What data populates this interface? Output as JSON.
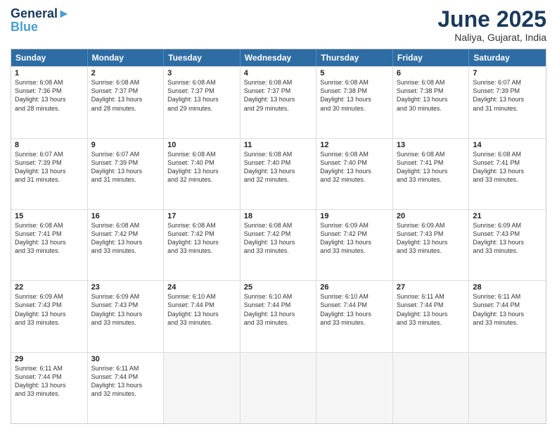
{
  "logo": {
    "line1": "General",
    "line2": "Blue"
  },
  "title": "June 2025",
  "location": "Naliya, Gujarat, India",
  "headers": [
    "Sunday",
    "Monday",
    "Tuesday",
    "Wednesday",
    "Thursday",
    "Friday",
    "Saturday"
  ],
  "rows": [
    [
      {
        "day": "",
        "text": ""
      },
      {
        "day": "2",
        "text": "Sunrise: 6:08 AM\nSunset: 7:37 PM\nDaylight: 13 hours\nand 28 minutes."
      },
      {
        "day": "3",
        "text": "Sunrise: 6:08 AM\nSunset: 7:37 PM\nDaylight: 13 hours\nand 29 minutes."
      },
      {
        "day": "4",
        "text": "Sunrise: 6:08 AM\nSunset: 7:37 PM\nDaylight: 13 hours\nand 29 minutes."
      },
      {
        "day": "5",
        "text": "Sunrise: 6:08 AM\nSunset: 7:38 PM\nDaylight: 13 hours\nand 30 minutes."
      },
      {
        "day": "6",
        "text": "Sunrise: 6:08 AM\nSunset: 7:38 PM\nDaylight: 13 hours\nand 30 minutes."
      },
      {
        "day": "7",
        "text": "Sunrise: 6:07 AM\nSunset: 7:39 PM\nDaylight: 13 hours\nand 31 minutes."
      }
    ],
    [
      {
        "day": "1",
        "text": "Sunrise: 6:08 AM\nSunset: 7:36 PM\nDaylight: 13 hours\nand 28 minutes."
      },
      {
        "day": "",
        "text": ""
      },
      {
        "day": "",
        "text": ""
      },
      {
        "day": "",
        "text": ""
      },
      {
        "day": "",
        "text": ""
      },
      {
        "day": "",
        "text": ""
      },
      {
        "day": "",
        "text": ""
      }
    ],
    [
      {
        "day": "8",
        "text": "Sunrise: 6:07 AM\nSunset: 7:39 PM\nDaylight: 13 hours\nand 31 minutes."
      },
      {
        "day": "9",
        "text": "Sunrise: 6:07 AM\nSunset: 7:39 PM\nDaylight: 13 hours\nand 31 minutes."
      },
      {
        "day": "10",
        "text": "Sunrise: 6:08 AM\nSunset: 7:40 PM\nDaylight: 13 hours\nand 32 minutes."
      },
      {
        "day": "11",
        "text": "Sunrise: 6:08 AM\nSunset: 7:40 PM\nDaylight: 13 hours\nand 32 minutes."
      },
      {
        "day": "12",
        "text": "Sunrise: 6:08 AM\nSunset: 7:40 PM\nDaylight: 13 hours\nand 32 minutes."
      },
      {
        "day": "13",
        "text": "Sunrise: 6:08 AM\nSunset: 7:41 PM\nDaylight: 13 hours\nand 33 minutes."
      },
      {
        "day": "14",
        "text": "Sunrise: 6:08 AM\nSunset: 7:41 PM\nDaylight: 13 hours\nand 33 minutes."
      }
    ],
    [
      {
        "day": "15",
        "text": "Sunrise: 6:08 AM\nSunset: 7:41 PM\nDaylight: 13 hours\nand 33 minutes."
      },
      {
        "day": "16",
        "text": "Sunrise: 6:08 AM\nSunset: 7:42 PM\nDaylight: 13 hours\nand 33 minutes."
      },
      {
        "day": "17",
        "text": "Sunrise: 6:08 AM\nSunset: 7:42 PM\nDaylight: 13 hours\nand 33 minutes."
      },
      {
        "day": "18",
        "text": "Sunrise: 6:08 AM\nSunset: 7:42 PM\nDaylight: 13 hours\nand 33 minutes."
      },
      {
        "day": "19",
        "text": "Sunrise: 6:09 AM\nSunset: 7:42 PM\nDaylight: 13 hours\nand 33 minutes."
      },
      {
        "day": "20",
        "text": "Sunrise: 6:09 AM\nSunset: 7:43 PM\nDaylight: 13 hours\nand 33 minutes."
      },
      {
        "day": "21",
        "text": "Sunrise: 6:09 AM\nSunset: 7:43 PM\nDaylight: 13 hours\nand 33 minutes."
      }
    ],
    [
      {
        "day": "22",
        "text": "Sunrise: 6:09 AM\nSunset: 7:43 PM\nDaylight: 13 hours\nand 33 minutes."
      },
      {
        "day": "23",
        "text": "Sunrise: 6:09 AM\nSunset: 7:43 PM\nDaylight: 13 hours\nand 33 minutes."
      },
      {
        "day": "24",
        "text": "Sunrise: 6:10 AM\nSunset: 7:44 PM\nDaylight: 13 hours\nand 33 minutes."
      },
      {
        "day": "25",
        "text": "Sunrise: 6:10 AM\nSunset: 7:44 PM\nDaylight: 13 hours\nand 33 minutes."
      },
      {
        "day": "26",
        "text": "Sunrise: 6:10 AM\nSunset: 7:44 PM\nDaylight: 13 hours\nand 33 minutes."
      },
      {
        "day": "27",
        "text": "Sunrise: 6:11 AM\nSunset: 7:44 PM\nDaylight: 13 hours\nand 33 minutes."
      },
      {
        "day": "28",
        "text": "Sunrise: 6:11 AM\nSunset: 7:44 PM\nDaylight: 13 hours\nand 33 minutes."
      }
    ],
    [
      {
        "day": "29",
        "text": "Sunrise: 6:11 AM\nSunset: 7:44 PM\nDaylight: 13 hours\nand 33 minutes."
      },
      {
        "day": "30",
        "text": "Sunrise: 6:11 AM\nSunset: 7:44 PM\nDaylight: 13 hours\nand 32 minutes."
      },
      {
        "day": "",
        "text": ""
      },
      {
        "day": "",
        "text": ""
      },
      {
        "day": "",
        "text": ""
      },
      {
        "day": "",
        "text": ""
      },
      {
        "day": "",
        "text": ""
      }
    ]
  ]
}
